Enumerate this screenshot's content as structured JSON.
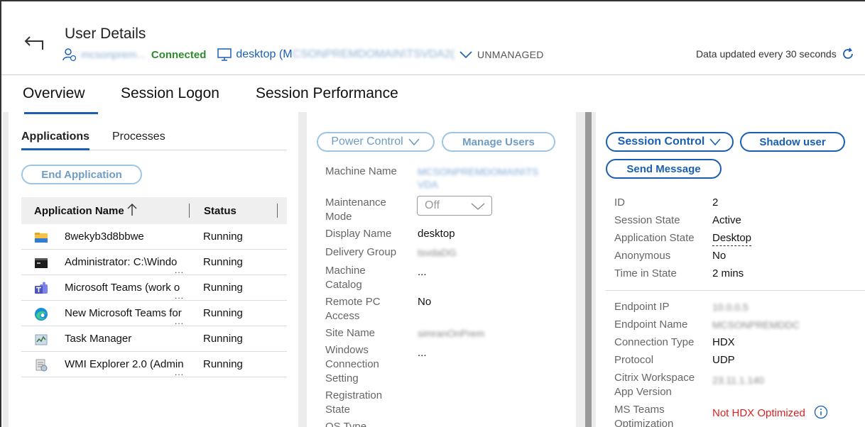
{
  "header": {
    "title": "User Details",
    "username": "mcsonprem...",
    "status": "Connected",
    "machine_prefix": "desktop (M",
    "machine_blur": "CSONPREMDOMAIN\\TSVDA2(",
    "management": "UNMANAGED",
    "updated_text": "Data updated every 30 seconds"
  },
  "tabs": [
    "Overview",
    "Session Logon",
    "Session Performance"
  ],
  "applications_panel": {
    "subtabs": [
      "Applications",
      "Processes"
    ],
    "end_button": "End Application",
    "columns": [
      "Application Name",
      "Status"
    ],
    "rows": [
      {
        "name": "8wekyb3d8bbwe",
        "status": "Running",
        "icon": "folder-icon",
        "truncated": false
      },
      {
        "name": "Administrator: C:\\Windo",
        "status": "Running",
        "icon": "console-icon",
        "truncated": true
      },
      {
        "name": "Microsoft Teams (work o",
        "status": "Running",
        "icon": "teams-icon",
        "truncated": true
      },
      {
        "name": "New Microsoft Teams for",
        "status": "Running",
        "icon": "edge-icon",
        "truncated": true
      },
      {
        "name": "Task Manager",
        "status": "Running",
        "icon": "task-manager-icon",
        "truncated": false
      },
      {
        "name": "WMI Explorer 2.0 (Admin",
        "status": "Running",
        "icon": "wmi-explorer-icon",
        "truncated": true
      }
    ],
    "ellipsis": "..."
  },
  "machine_panel": {
    "power_button": "Power Control",
    "manage_users_button": "Manage Users",
    "fields": {
      "machine_name": {
        "label": "Machine Name",
        "value1": "MCSONPREMDOMAIN\\TS",
        "value2": "VDA"
      },
      "maintenance_mode": {
        "label1": "Maintenance",
        "label2": "Mode",
        "value": "Off"
      },
      "display_name": {
        "label": "Display Name",
        "value": "desktop"
      },
      "delivery_group": {
        "label": "Delivery Group",
        "value": "tsvdaDG"
      },
      "machine_catalog": {
        "label1": "Machine",
        "label2": "Catalog",
        "value": "..."
      },
      "remote_pc_access": {
        "label1": "Remote PC",
        "label2": "Access",
        "value": "No"
      },
      "site_name": {
        "label": "Site Name",
        "value": "simranOnPrem"
      },
      "windows_connection": {
        "label1": "Windows",
        "label2": "Connection",
        "label3": "Setting",
        "value": "..."
      },
      "registration_state": {
        "label1": "Registration",
        "label2": "State"
      },
      "os_type": {
        "label": "OS Type",
        "value": "..."
      }
    }
  },
  "session_panel": {
    "session_control_button": "Session Control",
    "shadow_button": "Shadow user",
    "send_message_button": "Send Message",
    "session_fields": {
      "id": {
        "label": "ID",
        "value": "2"
      },
      "session_state": {
        "label": "Session State",
        "value": "Active"
      },
      "application_state": {
        "label": "Application State",
        "value": "Desktop"
      },
      "anonymous": {
        "label": "Anonymous",
        "value": "No"
      },
      "time_in_state": {
        "label": "Time in State",
        "value": "2 mins"
      }
    },
    "endpoint_fields": {
      "endpoint_ip": {
        "label": "Endpoint IP",
        "value": "10.0.0.5"
      },
      "endpoint_name": {
        "label": "Endpoint Name",
        "value": "MCSONPREMDDC"
      },
      "connection_type": {
        "label": "Connection Type",
        "value": "HDX"
      },
      "protocol": {
        "label": "Protocol",
        "value": "UDP"
      },
      "workspace_version": {
        "label1": "Citrix Workspace",
        "label2": "App Version",
        "value": "23.11.1.140"
      },
      "ms_teams": {
        "label1": "MS Teams",
        "label2": "Optimization",
        "value": "Not HDX Optimized"
      }
    }
  },
  "colors": {
    "accent": "#1a5fb4",
    "connected": "#2e8b2e",
    "error": "#e02020"
  }
}
